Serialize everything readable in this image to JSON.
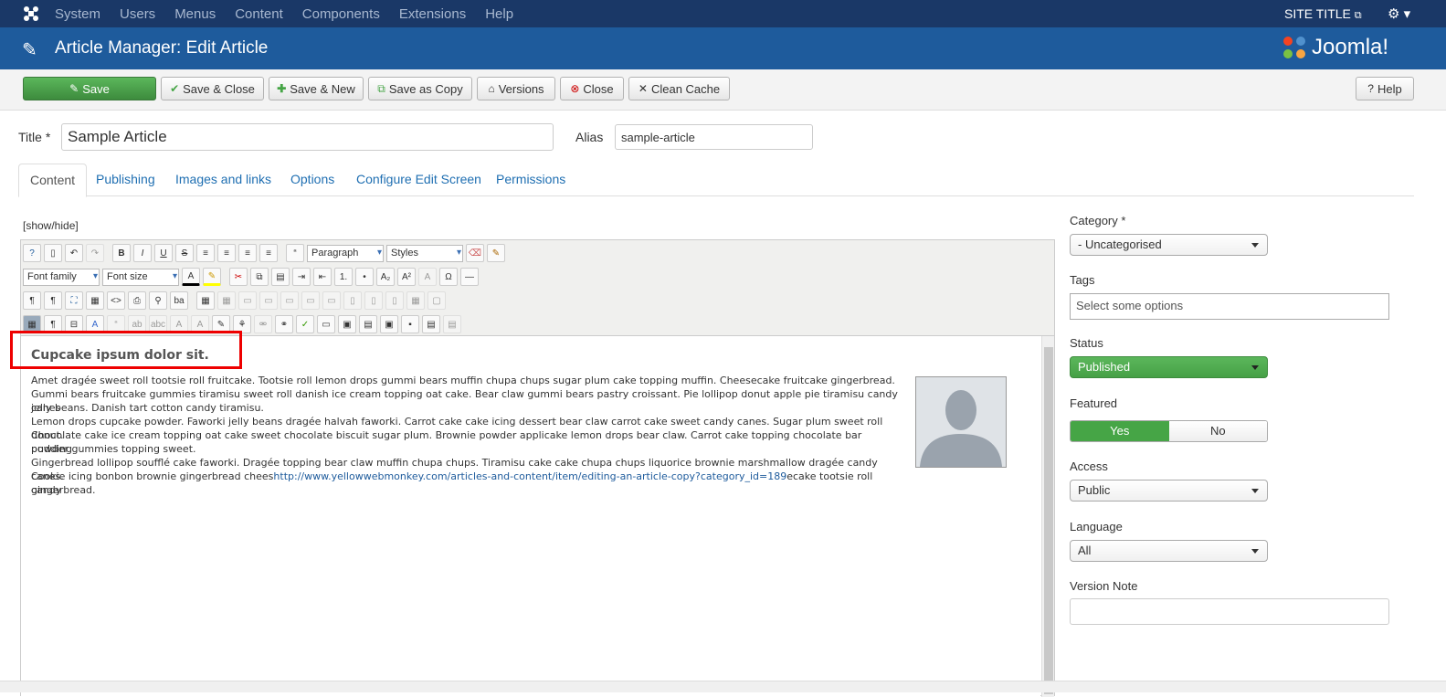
{
  "topnav": {
    "menu": [
      "System",
      "Users",
      "Menus",
      "Content",
      "Components",
      "Extensions",
      "Help"
    ],
    "site_title": "SITE TITLE"
  },
  "header": {
    "title": "Article Manager: Edit Article",
    "brand": "Joomla!"
  },
  "toolbar": {
    "save": "Save",
    "save_close": "Save & Close",
    "save_new": "Save & New",
    "save_copy": "Save as Copy",
    "versions": "Versions",
    "close": "Close",
    "clean_cache": "Clean Cache",
    "help": "Help"
  },
  "form": {
    "title_label": "Title *",
    "title_value": "Sample Article",
    "alias_label": "Alias",
    "alias_value": "sample-article"
  },
  "tabs": [
    "Content",
    "Publishing",
    "Images and links",
    "Options",
    "Configure Edit Screen",
    "Permissions"
  ],
  "editor": {
    "showhide": "[show/hide]",
    "paragraph": "Paragraph",
    "styles": "Styles",
    "font_family": "Font family",
    "font_size": "Font size",
    "heading": "Cupcake ipsum dolor sit.",
    "lines": [
      "Amet dragée sweet roll tootsie roll fruitcake. Tootsie roll lemon drops gummi bears muffin chupa chups sugar plum cake topping muffin. Cheesecake fruitcake gingerbread.",
      "Gummi bears fruitcake gummies tiramisu sweet roll danish ice cream topping oat cake. Bear claw gummi bears pastry croissant. Pie lollipop donut apple pie tiramisu candy canes",
      "jelly beans. Danish tart cotton candy tiramisu.",
      "Lemon drops cupcake powder. Faworki jelly beans dragée halvah faworki. Carrot cake cake icing dessert bear claw carrot cake sweet candy canes. Sugar plum sweet roll donut.",
      "Chocolate cake ice cream topping oat cake sweet chocolate biscuit sugar plum. Brownie powder applicake lemon drops bear claw. Carrot cake topping chocolate bar pudding",
      "powder gummies topping sweet.",
      "Gingerbread lollipop soufflé cake faworki. Dragée topping bear claw muffin chupa chups. Tiramisu cake cake chupa chups liquorice brownie marshmallow dragée candy canes."
    ],
    "link_pre": "Cookie icing bonbon brownie gingerbread chees",
    "link_url": "http://www.yellowwebmonkey.com/articles-and-content/item/editing-an-article-copy?category_id=189",
    "link_post": "ecake tootsie roll candy",
    "last_line": "gingerbread."
  },
  "sidebar": {
    "category_label": "Category *",
    "category_value": "- Uncategorised",
    "tags_label": "Tags",
    "tags_placeholder": "Select some options",
    "status_label": "Status",
    "status_value": "Published",
    "featured_label": "Featured",
    "featured_yes": "Yes",
    "featured_no": "No",
    "access_label": "Access",
    "access_value": "Public",
    "language_label": "Language",
    "language_value": "All",
    "version_note_label": "Version Note"
  },
  "colors": {
    "topnav": "#1a3867",
    "header": "#1e5b9c",
    "save": "#46a546",
    "link": "#1f6fb2"
  }
}
